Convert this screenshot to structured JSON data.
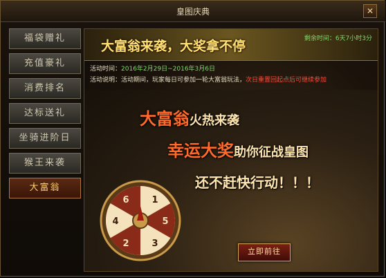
{
  "window": {
    "title": "皇图庆典",
    "close_label": "✕"
  },
  "nav": {
    "items": [
      {
        "label": "福袋赠礼",
        "active": false
      },
      {
        "label": "充值豪礼",
        "active": false
      },
      {
        "label": "消费排名",
        "active": false
      },
      {
        "label": "达标送礼",
        "active": false
      },
      {
        "label": "坐骑进阶日",
        "active": false
      },
      {
        "label": "猴王来袭",
        "active": false
      },
      {
        "label": "大富翁",
        "active": true
      }
    ]
  },
  "banner": {
    "title": "大富翁来袭，大奖拿不停",
    "remaining": "剩余时间：6天7小时3分"
  },
  "info": {
    "time_label": "活动时间：",
    "time_value": "2016年2月29日~2016年3月6日",
    "desc_label": "活动说明：",
    "desc_text": "活动期间，玩家每日可参加一轮大富翁玩法，",
    "desc_red": "次日重置回起点后可继续参加"
  },
  "scene": {
    "line1_big": "大富翁",
    "line1_rest": "火热来袭",
    "line2_big": "幸运大奖",
    "line2_rest": "助你征战皇图",
    "line3": "还不赶快行动！！！"
  },
  "wheel": {
    "numbers": [
      "1",
      "5",
      "3",
      "2",
      "4",
      "6"
    ]
  },
  "go_button": {
    "label": "立即前往"
  }
}
